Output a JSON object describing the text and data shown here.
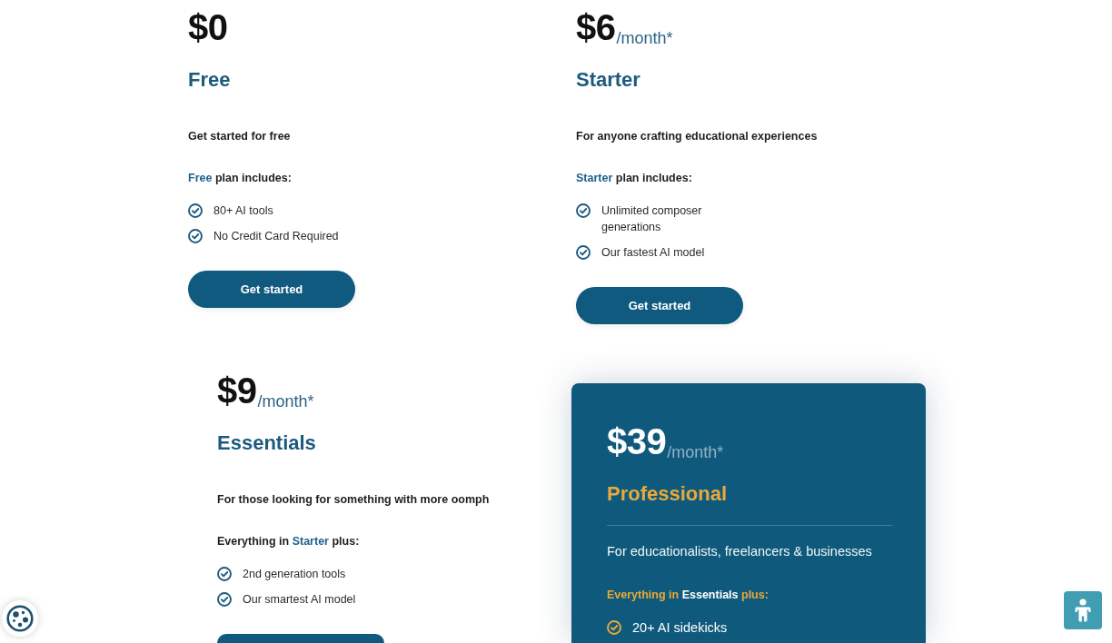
{
  "plans": [
    {
      "featured": false,
      "price": "$0",
      "name": "Free",
      "description": "Get started for free",
      "includes": [
        {
          "text": "Free",
          "highlight": true
        },
        {
          "text": "plan includes:",
          "highlight": false
        }
      ],
      "features": [
        "80+ AI tools",
        "No Credit Card Required"
      ],
      "button": {
        "kind": "full",
        "label": "Get started"
      }
    },
    {
      "featured": false,
      "price": "$6",
      "period": "/month*",
      "name": "Starter",
      "description": "For anyone crafting educational experiences",
      "includes": [
        {
          "text": "Starter",
          "highlight": true
        },
        {
          "text": "plan includes:",
          "highlight": false
        }
      ],
      "features": [
        "Unlimited composer generations",
        "Our fastest AI model"
      ],
      "button": {
        "kind": "full",
        "label": "Get started"
      }
    },
    {
      "featured": false,
      "price": "$9",
      "period": "/month*",
      "name": "Essentials",
      "description": "For those looking for something with more oomph",
      "includes": [
        {
          "text": "Everything in",
          "highlight": false
        },
        {
          "text": "Starter",
          "highlight": true
        },
        {
          "text": "plus:",
          "highlight": false
        }
      ],
      "features": [
        "2nd generation tools",
        "Our smartest AI model"
      ],
      "button": {
        "kind": "partial"
      }
    },
    {
      "featured": true,
      "price": "$39",
      "period": "/month*",
      "name": "Professional",
      "description": "For educationalists, freelancers & businesses",
      "includes": [
        {
          "text": "Everything in",
          "highlight": false
        },
        {
          "text": "Essentials",
          "highlight": true
        },
        {
          "text": "plus:",
          "highlight": false
        }
      ],
      "features": [
        "20+ AI sidekicks"
      ]
    }
  ]
}
